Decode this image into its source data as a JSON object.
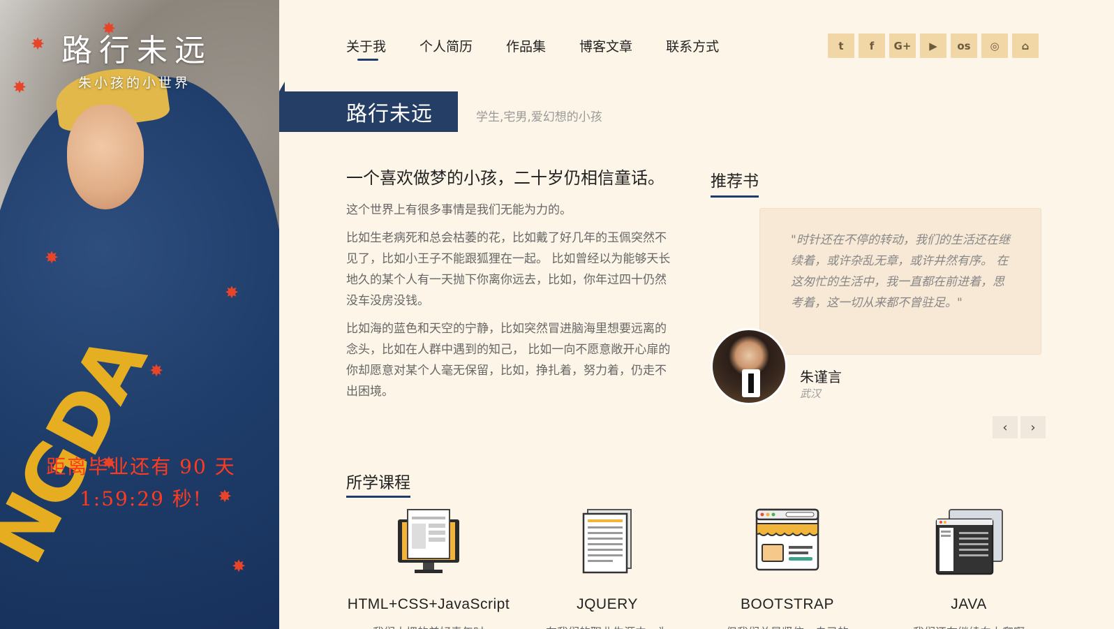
{
  "side": {
    "logo": "路行未远",
    "tagline": "朱小孩的小世界",
    "countdown_line1": "距离毕业还有 90 天",
    "countdown_line2": "1:59:29 秒!"
  },
  "nav": {
    "items": [
      "关于我",
      "个人简历",
      "作品集",
      "博客文章",
      "联系方式"
    ]
  },
  "social": [
    "twitter-icon",
    "facebook-icon",
    "google-plus-icon",
    "youtube-icon",
    "lastfm-icon",
    "dribbble-icon",
    "bus-icon"
  ],
  "social_glyphs": [
    "t",
    "f",
    "G+",
    "▶",
    "os",
    "◎",
    "⌂"
  ],
  "banner": {
    "title": "路行未远",
    "subtitle": "学生,宅男,爱幻想的小孩"
  },
  "intro": {
    "heading": "一个喜欢做梦的小孩，二十岁仍相信童话。",
    "p1": "这个世界上有很多事情是我们无能为力的。",
    "p2": "比如生老病死和总会枯萎的花，比如戴了好几年的玉佩突然不见了，比如小王子不能跟狐狸在一起。 比如曾经以为能够天长地久的某个人有一天抛下你离你远去，比如，你年过四十仍然没车没房没钱。",
    "p3": "比如海的蓝色和天空的宁静，比如突然冒进脑海里想要远离的念头，比如在人群中遇到的知己， 比如一向不愿意敞开心扉的你却愿意对某个人毫无保留，比如，挣扎着，努力着，仍走不出困境。"
  },
  "books": {
    "title": "推荐书",
    "quote": "\"时针还在不停的转动，我们的生活还在继续着，或许杂乱无章，或许井然有序。 在这匆忙的生活中，我一直都在前进着，思考着，这一切从来都不曾驻足。\"",
    "author": "朱谨言",
    "place": "武汉",
    "prev": "‹",
    "next": "›"
  },
  "courses": {
    "title": "所学课程",
    "items": [
      {
        "name": "HTML+CSS+JavaScript",
        "desc": "我们大把的美好青年时"
      },
      {
        "name": "JQUERY",
        "desc": "在我们的职业生涯中，为"
      },
      {
        "name": "BOOTSTRAP",
        "desc": "但我们总是坚信，自己的"
      },
      {
        "name": "JAVA",
        "desc": "我们还在继续向上爬啊"
      }
    ]
  }
}
